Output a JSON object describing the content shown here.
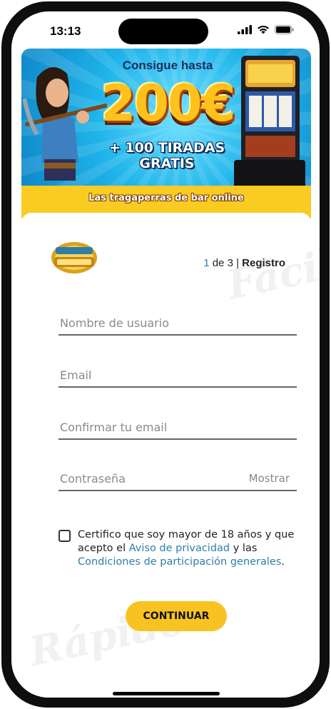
{
  "status_bar": {
    "time": "13:13"
  },
  "banner": {
    "headline": "Consigue hasta",
    "amount": "200€",
    "spins_line1": "+ 100 TIRADAS",
    "spins_line2": "GRATIS",
    "tagline": "Las tragaperras de bar online"
  },
  "header": {
    "step_current": "1",
    "step_of": " de 3 ",
    "step_separator": "| ",
    "step_title": "Registro"
  },
  "watermarks": {
    "top": "Fácil",
    "bottom": "Rápido"
  },
  "form": {
    "username": {
      "placeholder": "Nombre de usuario",
      "value": ""
    },
    "email": {
      "placeholder": "Email",
      "value": ""
    },
    "confirm_email": {
      "placeholder": "Confirmar tu email",
      "value": ""
    },
    "password": {
      "placeholder": "Contraseña",
      "value": "",
      "show_label": "Mostrar"
    },
    "consent": {
      "checked": false,
      "text_before": "Certifico que soy mayor de 18 años y que acepto el ",
      "privacy_link": "Aviso de privacidad",
      "text_middle": " y las ",
      "terms_link": "Condiciones de participación generales",
      "text_after": "."
    },
    "submit_label": "CONTINUAR"
  },
  "colors": {
    "accent_yellow": "#f8c322",
    "link_blue": "#2f7ea6",
    "banner_blue": "#1fb4ea"
  },
  "icons": [
    "signal-icon",
    "wifi-icon",
    "battery-icon"
  ]
}
